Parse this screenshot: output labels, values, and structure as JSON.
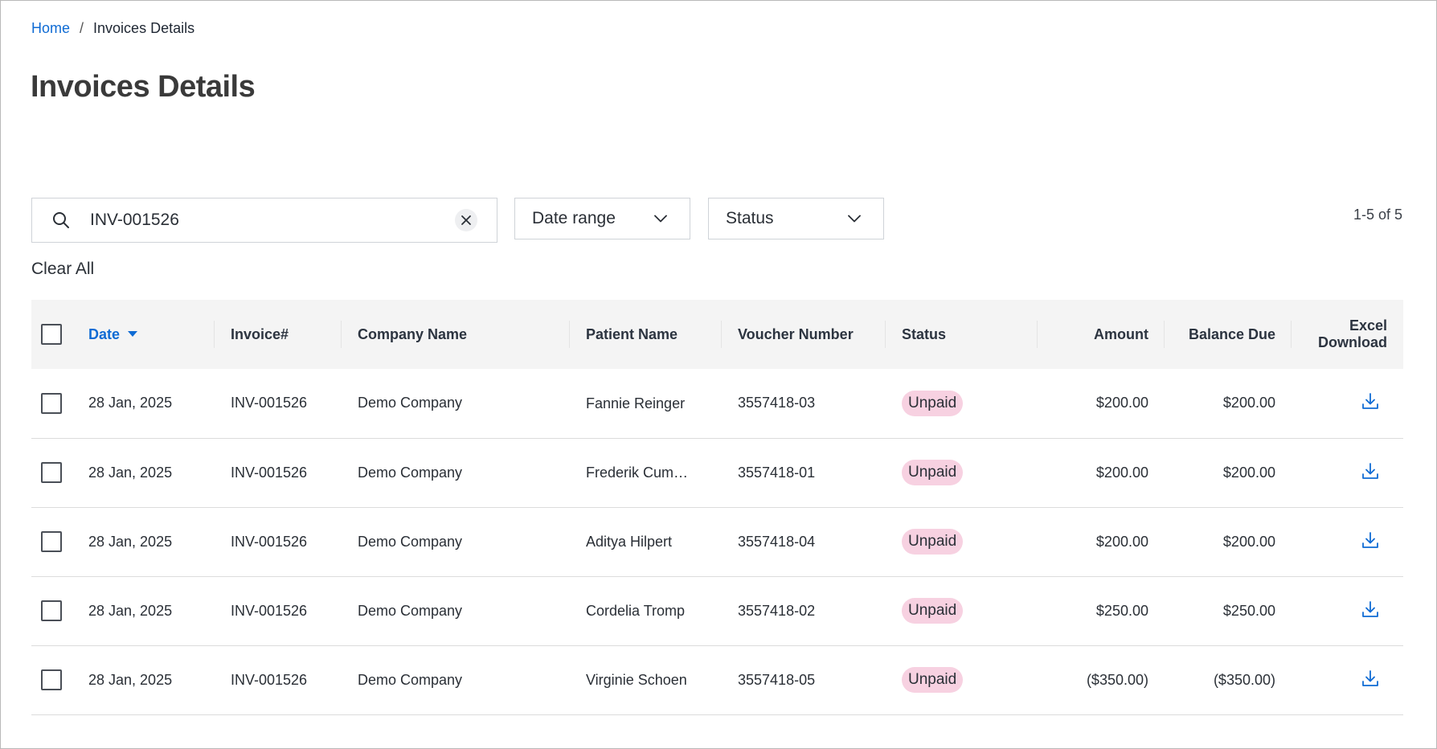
{
  "breadcrumb": {
    "home": "Home",
    "separator": "/",
    "current": "Invoices Details"
  },
  "page": {
    "title": "Invoices Details"
  },
  "search": {
    "value": "INV-001526",
    "icon": "search-icon",
    "clear_icon": "close-icon"
  },
  "filters": {
    "date_range": "Date range",
    "status": "Status"
  },
  "pagination": {
    "info": "1-5 of 5"
  },
  "clear_all": "Clear All",
  "colors": {
    "link": "#0f6bd4",
    "badge_unpaid": "#f7d1e1",
    "header_bg": "#f4f4f4"
  },
  "table": {
    "headers": {
      "date": "Date",
      "invoice": "Invoice#",
      "company": "Company Name",
      "patient": "Patient Name",
      "voucher": "Voucher Number",
      "status": "Status",
      "amount": "Amount",
      "balance": "Balance Due",
      "excel_line1": "Excel",
      "excel_line2": "Download"
    },
    "rows": [
      {
        "date": "28 Jan, 2025",
        "invoice": "INV-001526",
        "company": "Demo Company",
        "patient": "Fannie Reinger",
        "voucher": "3557418-03",
        "status": "Unpaid",
        "amount": "$200.00",
        "balance": "$200.00"
      },
      {
        "date": "28 Jan, 2025",
        "invoice": "INV-001526",
        "company": "Demo Company",
        "patient": "Frederik Cum…",
        "voucher": "3557418-01",
        "status": "Unpaid",
        "amount": "$200.00",
        "balance": "$200.00"
      },
      {
        "date": "28 Jan, 2025",
        "invoice": "INV-001526",
        "company": "Demo Company",
        "patient": "Aditya Hilpert",
        "voucher": "3557418-04",
        "status": "Unpaid",
        "amount": "$200.00",
        "balance": "$200.00"
      },
      {
        "date": "28 Jan, 2025",
        "invoice": "INV-001526",
        "company": "Demo Company",
        "patient": "Cordelia Tromp",
        "voucher": "3557418-02",
        "status": "Unpaid",
        "amount": "$250.00",
        "balance": "$250.00"
      },
      {
        "date": "28 Jan, 2025",
        "invoice": "INV-001526",
        "company": "Demo Company",
        "patient": "Virginie Schoen",
        "voucher": "3557418-05",
        "status": "Unpaid",
        "amount": "($350.00)",
        "balance": "($350.00)"
      }
    ]
  }
}
